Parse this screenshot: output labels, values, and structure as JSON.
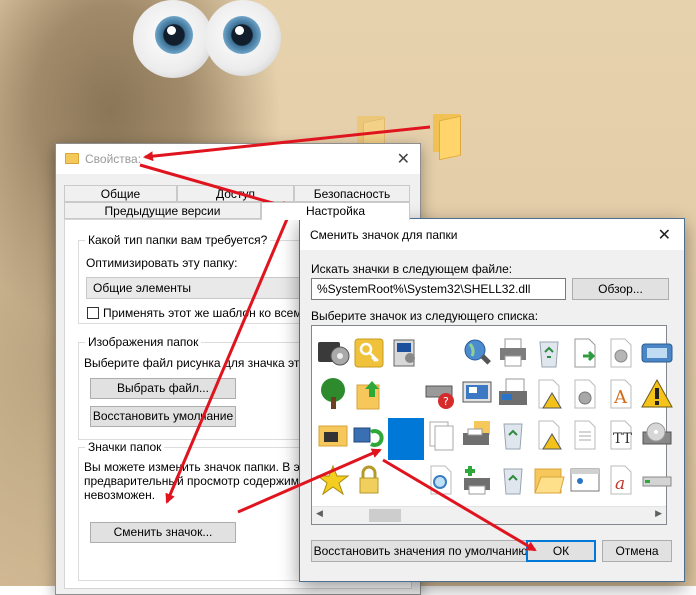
{
  "properties_dialog": {
    "title": "Свойства:",
    "tabs_row1": [
      "Общие",
      "Доступ",
      "Безопасность"
    ],
    "tabs_row2": [
      "Предыдущие версии",
      "Настройка"
    ],
    "active_tab": "Настройка",
    "folder_type": {
      "heading": "Какой тип папки вам требуется?",
      "optimize_label": "Оптимизировать эту папку:",
      "optimize_value": "Общие элементы",
      "apply_subfolders": "Применять этот же шаблон ко всем п"
    },
    "folder_images": {
      "heading": "Изображения папок",
      "description": "Выберите файл рисунка для значка этой п",
      "choose_file": "Выбрать файл...",
      "restore_default": "Восстановить умолчание"
    },
    "folder_icons": {
      "heading": "Значки папок",
      "description_line1": "Вы можете изменить значок папки. В это",
      "description_line2": "предварительный просмотр содержимог",
      "description_line3": "невозможен.",
      "change_icon": "Сменить значок..."
    }
  },
  "change_icon_dialog": {
    "title": "Сменить значок для папки",
    "search_label": "Искать значки в следующем файле:",
    "file_path": "%SystemRoot%\\System32\\SHELL32.dll",
    "browse_button": "Обзор...",
    "list_label": "Выберите значок из следующего списка:",
    "icons": [
      [
        "media-player-icon",
        "key-icon",
        "system-settings-icon",
        "",
        "search-globe-icon",
        "printer-icon",
        "recycle-bin-icon",
        "document-arrow-icon",
        "gear-document-icon",
        "drive-icon"
      ],
      [
        "tree-icon",
        "folder-up-icon",
        "",
        "network-error-icon",
        "display-settings-icon",
        "fax-icon",
        "warning-document-icon",
        "settings-document-icon",
        "font-a-icon",
        "warning-icon"
      ],
      [
        "folder-network-icon",
        "network-sync-icon",
        "blank-selected-icon",
        "documents-icon",
        "printer-folder-icon",
        "recycle-bin-full-icon",
        "document-warning-icon",
        "text-document-icon",
        "font-tt-icon",
        "disc-drive-icon"
      ],
      [
        "star-icon",
        "lock-icon",
        "",
        "magnifier-document-icon",
        "printer-add-icon",
        "recycle-bin-empty-icon",
        "folder-open-icon",
        "window-icon",
        "font-a-red-icon",
        "usb-drive-icon"
      ]
    ],
    "selected_icon": "blank-selected-icon",
    "restore_defaults_button": "Восстановить значения по умолчанию",
    "ok_button": "ОК",
    "cancel_button": "Отмена"
  },
  "colors": {
    "arrow": "#e0141e",
    "selection": "#0078d7",
    "dialog_bg": "#f0f0f0"
  }
}
